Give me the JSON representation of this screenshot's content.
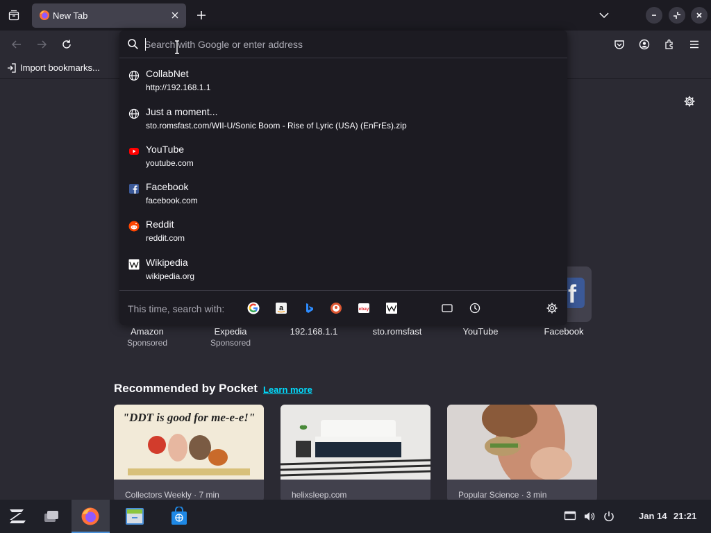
{
  "tab": {
    "title": "New Tab"
  },
  "bookmarks": {
    "import_label": "Import bookmarks..."
  },
  "urlbar": {
    "placeholder": "Search with Google or enter address",
    "results": [
      {
        "title": "CollabNet",
        "url": "http://192.168.1.1",
        "icon": "globe-icon"
      },
      {
        "title": "Just a moment...",
        "url": "sto.romsfast.com/WII-U/Sonic Boom - Rise of Lyric (USA) (EnFrEs).zip",
        "icon": "globe-icon"
      },
      {
        "title": "YouTube",
        "url": "youtube.com",
        "icon": "youtube-icon"
      },
      {
        "title": "Facebook",
        "url": "facebook.com",
        "icon": "facebook-icon"
      },
      {
        "title": "Reddit",
        "url": "reddit.com",
        "icon": "reddit-icon"
      },
      {
        "title": "Wikipedia",
        "url": "wikipedia.org",
        "icon": "wikipedia-icon"
      }
    ],
    "oneoff_label": "This time, search with:",
    "engines": [
      "google-icon",
      "amazon-icon",
      "bing-icon",
      "duckduckgo-icon",
      "ebay-icon",
      "wikipedia-icon",
      "tabs-icon",
      "history-icon",
      "search-settings-icon"
    ]
  },
  "top_sites": [
    {
      "name": "Amazon",
      "sponsored": "Sponsored"
    },
    {
      "name": "Expedia",
      "sponsored": "Sponsored"
    },
    {
      "name": "192.168.1.1"
    },
    {
      "name": "sto.romsfast"
    },
    {
      "name": "YouTube"
    },
    {
      "name": "Facebook"
    }
  ],
  "pocket": {
    "heading": "Recommended by Pocket",
    "learn_more": "Learn more",
    "cards": [
      {
        "source": "Collectors Weekly · 7 min",
        "image_text": "\"DDT is good for me-e-e!\""
      },
      {
        "source": "helixsleep.com"
      },
      {
        "source": "Popular Science · 3 min"
      }
    ]
  },
  "taskbar": {
    "date": "Jan 14",
    "time": "21:21"
  },
  "colors": {
    "accent": "#00ddff",
    "toolbar": "#2b2a33",
    "panel": "#1c1b22"
  }
}
